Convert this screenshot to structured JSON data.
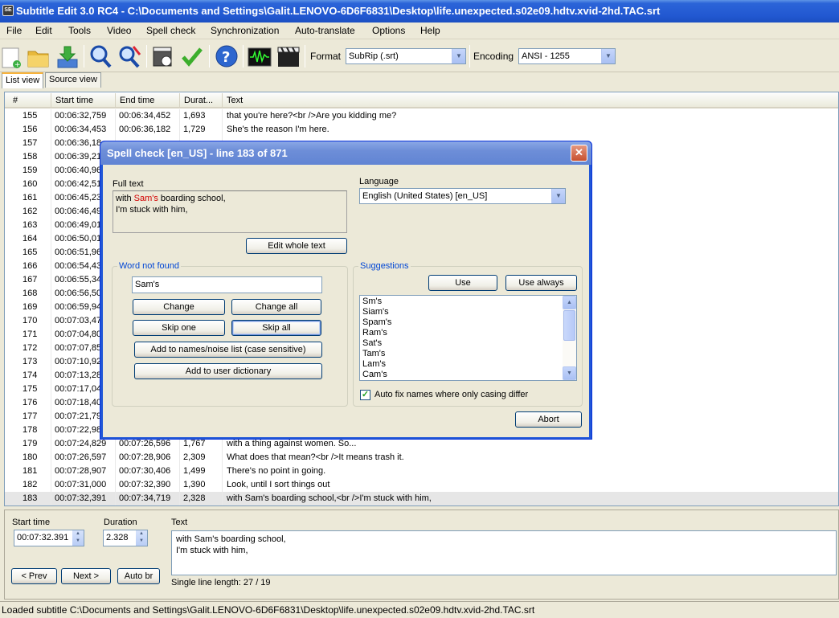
{
  "window": {
    "title": "Subtitle Edit 3.0 RC4 - C:\\Documents and Settings\\Galit.LENOVO-6D6F6831\\Desktop\\life.unexpected.s02e09.hdtv.xvid-2hd.TAC.srt",
    "icon_text": "SE"
  },
  "menu": [
    "File",
    "Edit",
    "Tools",
    "Video",
    "Spell check",
    "Synchronization",
    "Auto-translate",
    "Options",
    "Help"
  ],
  "toolbar": {
    "format_label": "Format",
    "format_value": "SubRip (.srt)",
    "encoding_label": "Encoding",
    "encoding_value": "ANSI - 1255",
    "icons": [
      "new-file-icon",
      "open-folder-icon",
      "download-icon",
      "find-icon",
      "replace-icon",
      "visual-sync-icon",
      "spell-check-icon",
      "help-icon",
      "waveform-icon",
      "video-clapper-icon"
    ]
  },
  "tabs": [
    "List view",
    "Source view"
  ],
  "list": {
    "columns": [
      "#",
      "Start time",
      "End time",
      "Durat...",
      "Text"
    ],
    "rows": [
      [
        "155",
        "00:06:32,759",
        "00:06:34,452",
        "1,693",
        "that you're here?<br />Are you kidding me?"
      ],
      [
        "156",
        "00:06:34,453",
        "00:06:36,182",
        "1,729",
        "She's the reason I'm here."
      ],
      [
        "157",
        "00:06:36,18",
        "",
        "",
        ""
      ],
      [
        "158",
        "00:06:39,21",
        "",
        "",
        ""
      ],
      [
        "159",
        "00:06:40,96",
        "",
        "",
        ""
      ],
      [
        "160",
        "00:06:42,51",
        "",
        "",
        ""
      ],
      [
        "161",
        "00:06:45,23",
        "",
        "",
        ""
      ],
      [
        "162",
        "00:06:46,49",
        "",
        "",
        ""
      ],
      [
        "163",
        "00:06:49,01",
        "",
        "",
        ""
      ],
      [
        "164",
        "00:06:50,01",
        "",
        "",
        ""
      ],
      [
        "165",
        "00:06:51,96",
        "",
        "",
        ""
      ],
      [
        "166",
        "00:06:54,43",
        "",
        "",
        ""
      ],
      [
        "167",
        "00:06:55,34",
        "",
        "",
        ""
      ],
      [
        "168",
        "00:06:56,50",
        "",
        "",
        ""
      ],
      [
        "169",
        "00:06:59,94",
        "",
        "",
        ""
      ],
      [
        "170",
        "00:07:03,47",
        "",
        "",
        ""
      ],
      [
        "171",
        "00:07:04,80",
        "",
        "",
        ""
      ],
      [
        "172",
        "00:07:07,85",
        "",
        "",
        ""
      ],
      [
        "173",
        "00:07:10,92",
        "",
        "",
        ""
      ],
      [
        "174",
        "00:07:13,28",
        "",
        "",
        ""
      ],
      [
        "175",
        "00:07:17,04",
        "",
        "",
        ""
      ],
      [
        "176",
        "00:07:18,40",
        "",
        "",
        ""
      ],
      [
        "177",
        "00:07:21,79",
        "",
        "",
        ""
      ],
      [
        "178",
        "00:07:22,98",
        "",
        "",
        ""
      ],
      [
        "179",
        "00:07:24,829",
        "00:07:26,596",
        "1,767",
        "with a thing against women. So..."
      ],
      [
        "180",
        "00:07:26,597",
        "00:07:28,906",
        "2,309",
        "What does that mean?<br />It means trash it."
      ],
      [
        "181",
        "00:07:28,907",
        "00:07:30,406",
        "1,499",
        "There's no point in going."
      ],
      [
        "182",
        "00:07:31,000",
        "00:07:32,390",
        "1,390",
        "Look, until I sort things out"
      ],
      [
        "183",
        "00:07:32,391",
        "00:07:34,719",
        "2,328",
        "with Sam's boarding school,<br />I'm stuck with him,"
      ]
    ],
    "selected_row": 28
  },
  "edit": {
    "start_time_label": "Start time",
    "start_time_value": "00:07:32.391",
    "duration_label": "Duration",
    "duration_value": "2.328",
    "text_label": "Text",
    "text_line1": "with Sam's boarding school,",
    "text_line2": "I'm stuck with him,",
    "prev_label": "< Prev",
    "next_label": "Next >",
    "autobr_label": "Auto br",
    "line_length": "Single line length: 27 / 19"
  },
  "status": "Loaded subtitle C:\\Documents and Settings\\Galit.LENOVO-6D6F6831\\Desktop\\life.unexpected.s02e09.hdtv.xvid-2hd.TAC.srt",
  "dialog": {
    "title": "Spell check [en_US] - line 183 of 871",
    "full_text_label": "Full text",
    "full_text_pre": "with ",
    "full_text_word": "Sam's",
    "full_text_post": " boarding school,",
    "full_text_line2": "I'm stuck with him,",
    "edit_whole_text": "Edit whole text",
    "language_label": "Language",
    "language_value": "English (United States) [en_US]",
    "word_not_found_label": "Word not found",
    "word_value": "Sam's",
    "change": "Change",
    "change_all": "Change all",
    "skip_one": "Skip one",
    "skip_all": "Skip all",
    "add_names": "Add to names/noise list (case sensitive)",
    "add_dictionary": "Add to user dictionary",
    "suggestions_label": "Suggestions",
    "use": "Use",
    "use_always": "Use always",
    "suggestions": [
      "Sm's",
      "Siam's",
      "Spam's",
      "Ram's",
      "Sat's",
      "Tam's",
      "Lam's",
      "Cam's"
    ],
    "auto_fix_label": "Auto fix names where only casing differ",
    "auto_fix_checked": true,
    "abort": "Abort"
  }
}
